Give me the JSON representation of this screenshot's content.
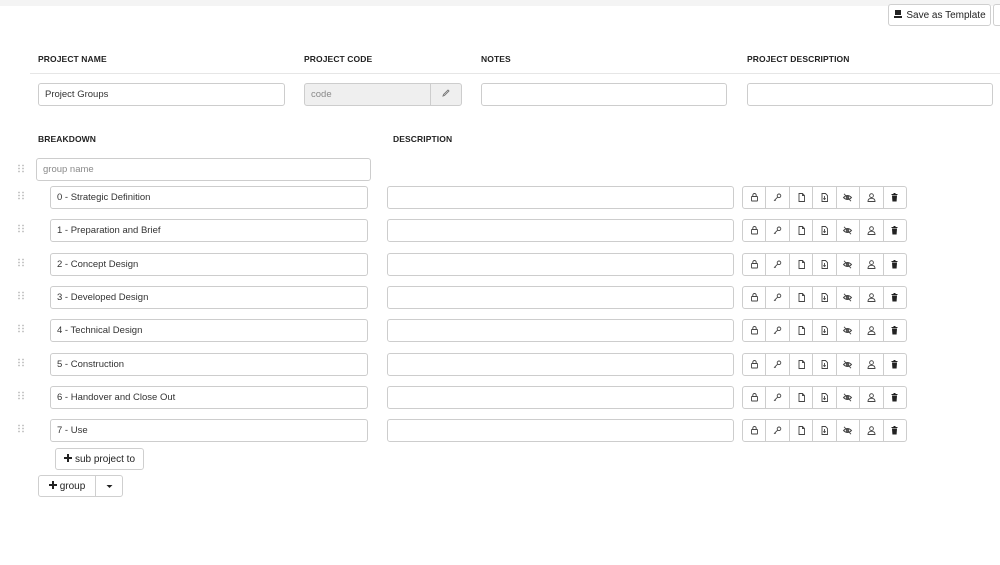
{
  "toolbar": {
    "save_template_label": "Save as Template"
  },
  "headers": {
    "project_name": "PROJECT NAME",
    "project_code": "PROJECT CODE",
    "notes": "NOTES",
    "project_description": "PROJECT DESCRIPTION",
    "breakdown": "BREAKDOWN",
    "description": "DESCRIPTION"
  },
  "fields": {
    "project_name_value": "Project Groups",
    "project_code_placeholder": "code",
    "notes_value": "",
    "project_description_value": ""
  },
  "group": {
    "name_placeholder": "group name"
  },
  "stages": [
    {
      "label": "0 - Strategic Definition",
      "description": ""
    },
    {
      "label": "1 - Preparation and Brief",
      "description": ""
    },
    {
      "label": "2 - Concept Design",
      "description": ""
    },
    {
      "label": "3 - Developed Design",
      "description": ""
    },
    {
      "label": "4 - Technical Design",
      "description": ""
    },
    {
      "label": "5 - Construction",
      "description": ""
    },
    {
      "label": "6 - Handover and Close Out",
      "description": ""
    },
    {
      "label": "7 - Use",
      "description": ""
    }
  ],
  "row_actions": [
    "lock-icon",
    "key-icon",
    "document-icon",
    "document-download-icon",
    "eye-off-icon",
    "user-icon",
    "trash-icon"
  ],
  "buttons": {
    "sub_project_label": "sub project to",
    "group_label": "group"
  },
  "icons": {
    "save": "save-template-icon",
    "plus": "plus-icon",
    "caret": "caret-down-icon",
    "grip": "drag-handle-icon",
    "pencil": "pencil-icon"
  },
  "colors": {
    "border": "#cdcdcd",
    "disabled_bg": "#efefef",
    "text": "#222222"
  }
}
